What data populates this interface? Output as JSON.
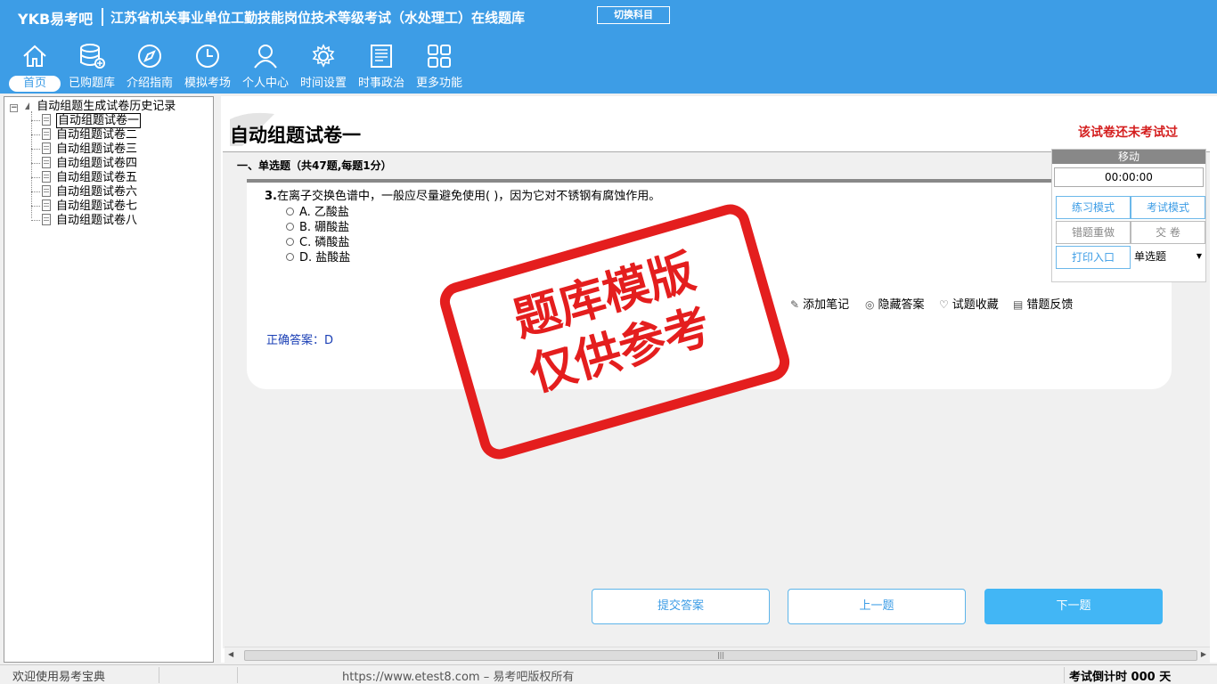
{
  "header": {
    "brand": "YKB易考吧",
    "title": "江苏省机关事业单位工勤技能岗位技术等级考试（水处理工）在线题库",
    "switch_label": "切换科目",
    "nav": [
      {
        "label": "首页",
        "icon": "home-icon"
      },
      {
        "label": "已购题库",
        "icon": "database-icon"
      },
      {
        "label": "介绍指南",
        "icon": "compass-icon"
      },
      {
        "label": "模拟考场",
        "icon": "clock-icon"
      },
      {
        "label": "个人中心",
        "icon": "user-icon"
      },
      {
        "label": "时间设置",
        "icon": "gear-icon"
      },
      {
        "label": "时事政治",
        "icon": "newspaper-icon"
      },
      {
        "label": "更多功能",
        "icon": "grid-icon"
      }
    ]
  },
  "tree": {
    "root": "自动组题生成试卷历史记录",
    "items": [
      "自动组题试卷一",
      "自动组题试卷二",
      "自动组题试卷三",
      "自动组题试卷四",
      "自动组题试卷五",
      "自动组题试卷六",
      "自动组题试卷七",
      "自动组题试卷八"
    ]
  },
  "main": {
    "paper_title": "自动组题试卷一",
    "paper_status": "该试卷还未考试过",
    "section_title": "一、单选题（共47题,每题1分）",
    "question": {
      "number": "3.",
      "text": "在离子交换色谱中，一般应尽量避免使用( )，因为它对不锈钢有腐蚀作用。",
      "options": [
        "A. 乙酸盐",
        "B. 硼酸盐",
        "C. 磷酸盐",
        "D. 盐酸盐"
      ]
    },
    "tools": [
      "添加笔记",
      "隐藏答案",
      "试题收藏",
      "错题反馈"
    ],
    "answer": "正确答案：D"
  },
  "stamp": {
    "line1": "题库模版",
    "line2": "仅供参考",
    "color": "#e41e1e"
  },
  "float_panel": {
    "title": "移动",
    "timer": "00:00:00",
    "practice_mode": "练习模式",
    "exam_mode": "考试模式",
    "redo_wrong": "错题重做",
    "submit_paper": "交    卷",
    "print_entry": "打印入口",
    "question_type": "单选题"
  },
  "bottom": {
    "submit": "提交答案",
    "prev": "上一题",
    "next": "下一题"
  },
  "status": {
    "left": "欢迎使用易考宝典",
    "mid": "https://www.etest8.com – 易考吧版权所有",
    "right": "考试倒计时 000 天"
  },
  "colors": {
    "header_bg": "#3d9de6",
    "accent": "#42b6f5",
    "status_red": "#d41e1e"
  }
}
